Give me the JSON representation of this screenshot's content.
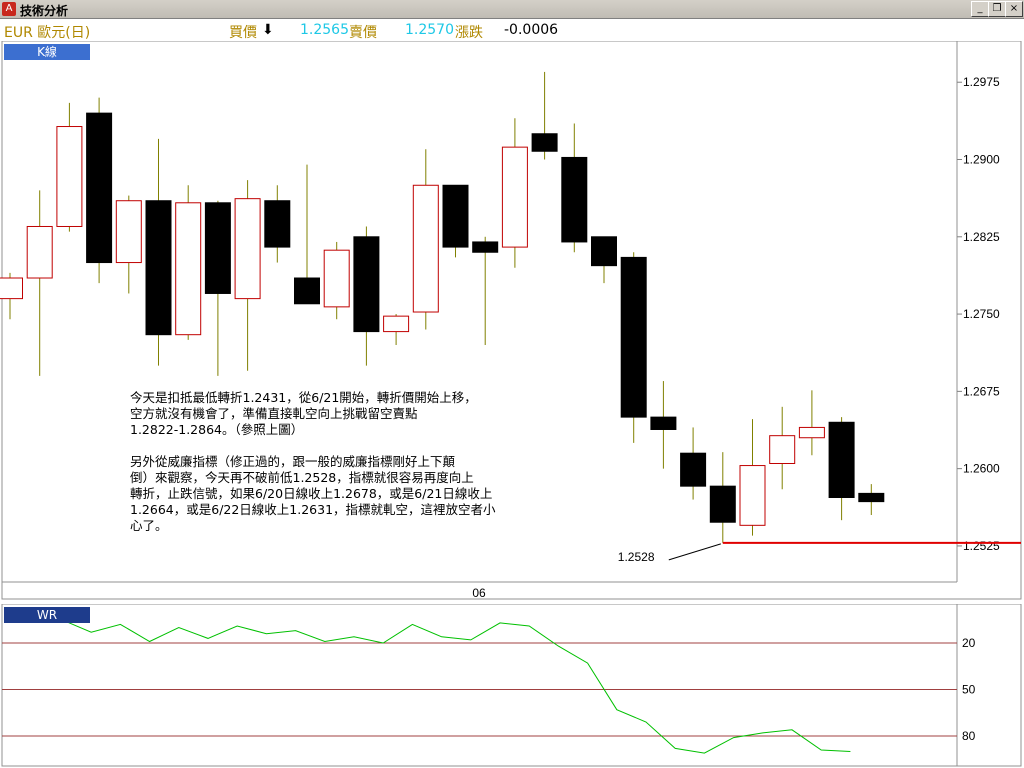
{
  "window": {
    "title": "技術分析",
    "buttons": {
      "minimize": "_",
      "restore": "❐",
      "close": "×"
    }
  },
  "quote": {
    "symbol": "EUR 歐元(日)",
    "bid_label": "買價",
    "bid_arrow": "⬇",
    "bid_value": "1.2565",
    "ask_label": "賣價",
    "ask_value": "1.2570",
    "change_label": "漲跌",
    "change_value": "-0.0006"
  },
  "colors": {
    "bull": "#c00000",
    "bear": "#000000",
    "wick": "#808000",
    "support_line": "#e00000",
    "wr_line": "#00c000",
    "wr_level_line": "#a04040",
    "panel_tag_bg": "#3c6fd0",
    "wr_tag_bg": "#1e3c8c"
  },
  "panels": {
    "kline_label": "K線",
    "wr_label": "WR",
    "xaxis_label": "06"
  },
  "chart_data": {
    "type": "candlestick",
    "ylim": [
      1.249,
      1.3015
    ],
    "yticks": [
      "1.2975",
      "1.2900",
      "1.2825",
      "1.2750",
      "1.2675",
      "1.2600",
      "1.2525"
    ],
    "candles": [
      {
        "o": 1.2765,
        "h": 1.279,
        "l": 1.2745,
        "c": 1.2785
      },
      {
        "o": 1.2785,
        "h": 1.287,
        "l": 1.269,
        "c": 1.2835
      },
      {
        "o": 1.2835,
        "h": 1.2955,
        "l": 1.283,
        "c": 1.2932
      },
      {
        "o": 1.2945,
        "h": 1.296,
        "l": 1.278,
        "c": 1.28
      },
      {
        "o": 1.28,
        "h": 1.2865,
        "l": 1.277,
        "c": 1.286
      },
      {
        "o": 1.286,
        "h": 1.292,
        "l": 1.27,
        "c": 1.273
      },
      {
        "o": 1.273,
        "h": 1.2875,
        "l": 1.2725,
        "c": 1.2858
      },
      {
        "o": 1.2858,
        "h": 1.286,
        "l": 1.269,
        "c": 1.277
      },
      {
        "o": 1.2765,
        "h": 1.288,
        "l": 1.2695,
        "c": 1.2862
      },
      {
        "o": 1.286,
        "h": 1.2875,
        "l": 1.28,
        "c": 1.2815
      },
      {
        "o": 1.2785,
        "h": 1.2895,
        "l": 1.276,
        "c": 1.276
      },
      {
        "o": 1.2757,
        "h": 1.282,
        "l": 1.2745,
        "c": 1.2812
      },
      {
        "o": 1.2825,
        "h": 1.2835,
        "l": 1.27,
        "c": 1.2733
      },
      {
        "o": 1.2733,
        "h": 1.275,
        "l": 1.272,
        "c": 1.2748
      },
      {
        "o": 1.2752,
        "h": 1.291,
        "l": 1.2735,
        "c": 1.2875
      },
      {
        "o": 1.2875,
        "h": 1.2875,
        "l": 1.2805,
        "c": 1.2815
      },
      {
        "o": 1.282,
        "h": 1.2825,
        "l": 1.272,
        "c": 1.281
      },
      {
        "o": 1.2815,
        "h": 1.294,
        "l": 1.2795,
        "c": 1.2912
      },
      {
        "o": 1.2925,
        "h": 1.2985,
        "l": 1.29,
        "c": 1.2908
      },
      {
        "o": 1.2902,
        "h": 1.2935,
        "l": 1.281,
        "c": 1.282
      },
      {
        "o": 1.2825,
        "h": 1.2825,
        "l": 1.278,
        "c": 1.2797
      },
      {
        "o": 1.2805,
        "h": 1.281,
        "l": 1.2625,
        "c": 1.265
      },
      {
        "o": 1.265,
        "h": 1.2685,
        "l": 1.26,
        "c": 1.2638
      },
      {
        "o": 1.2615,
        "h": 1.264,
        "l": 1.257,
        "c": 1.2583
      },
      {
        "o": 1.2583,
        "h": 1.2616,
        "l": 1.2528,
        "c": 1.2548
      },
      {
        "o": 1.2545,
        "h": 1.2648,
        "l": 1.2535,
        "c": 1.2603
      },
      {
        "o": 1.2605,
        "h": 1.266,
        "l": 1.258,
        "c": 1.2632
      },
      {
        "o": 1.263,
        "h": 1.2676,
        "l": 1.2613,
        "c": 1.264
      },
      {
        "o": 1.2645,
        "h": 1.265,
        "l": 1.255,
        "c": 1.2572
      },
      {
        "o": 1.2576,
        "h": 1.2585,
        "l": 1.2555,
        "c": 1.2568
      }
    ],
    "support": {
      "value": 1.2528,
      "label": "1.2528"
    },
    "wr": {
      "levels": [
        20,
        50,
        80
      ],
      "ylim": [
        0,
        100
      ],
      "values": [
        5,
        13,
        8,
        19,
        10,
        17,
        9,
        14,
        12,
        19,
        16,
        20,
        8,
        16,
        18,
        7,
        9,
        22,
        33,
        63,
        71,
        88,
        91,
        81,
        78,
        76,
        89,
        90
      ]
    }
  },
  "annotation": {
    "paragraph1": "今天是扣抵最低轉折1.2431，從6/21開始，轉折價開始上移，\n空方就沒有機會了，準備直接軋空向上挑戰留空賣點\n1.2822-1.2864。（參照上圖）",
    "paragraph2": "另外從威廉指標（修正過的，跟一般的威廉指標剛好上下顛\n倒）來觀察，今天再不破前低1.2528，指標就很容易再度向上\n轉折，止跌信號，如果6/20日線收上1.2678，或是6/21日線收上\n1.2664，或是6/22日線收上1.2631，指標就軋空，這裡放空者小\n心了。"
  }
}
